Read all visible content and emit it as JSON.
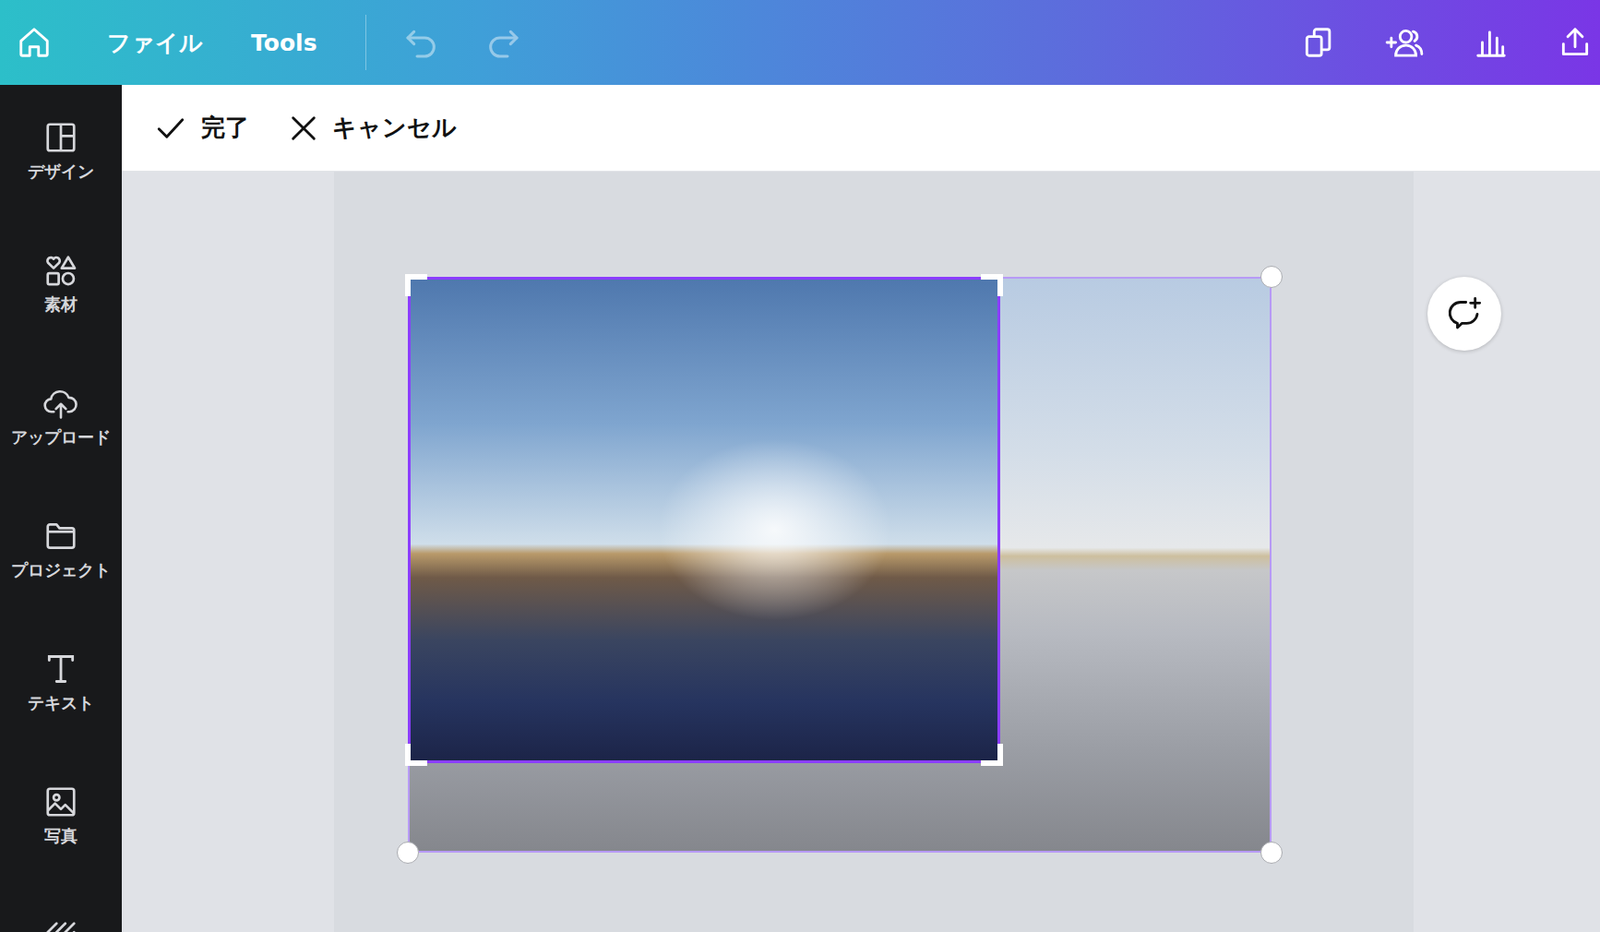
{
  "top_bar": {
    "menu": [
      "ファイル",
      "Tools"
    ],
    "history": [
      {
        "disabled": true
      },
      {
        "disabled": true
      }
    ]
  },
  "toolbar": {
    "buttons": [
      {
        "label": "完了",
        "kind": "confirm"
      },
      {
        "label": "キャンセル",
        "kind": "cancel"
      }
    ]
  },
  "sidebar": {
    "items": [
      {
        "label": "デザイン",
        "kind": "design"
      },
      {
        "label": "素材",
        "kind": "elements"
      },
      {
        "label": "アップロード",
        "kind": "upload"
      },
      {
        "label": "プロジェクト",
        "kind": "projects"
      },
      {
        "label": "テキスト",
        "kind": "text"
      },
      {
        "label": "写真",
        "kind": "photos"
      }
    ]
  }
}
